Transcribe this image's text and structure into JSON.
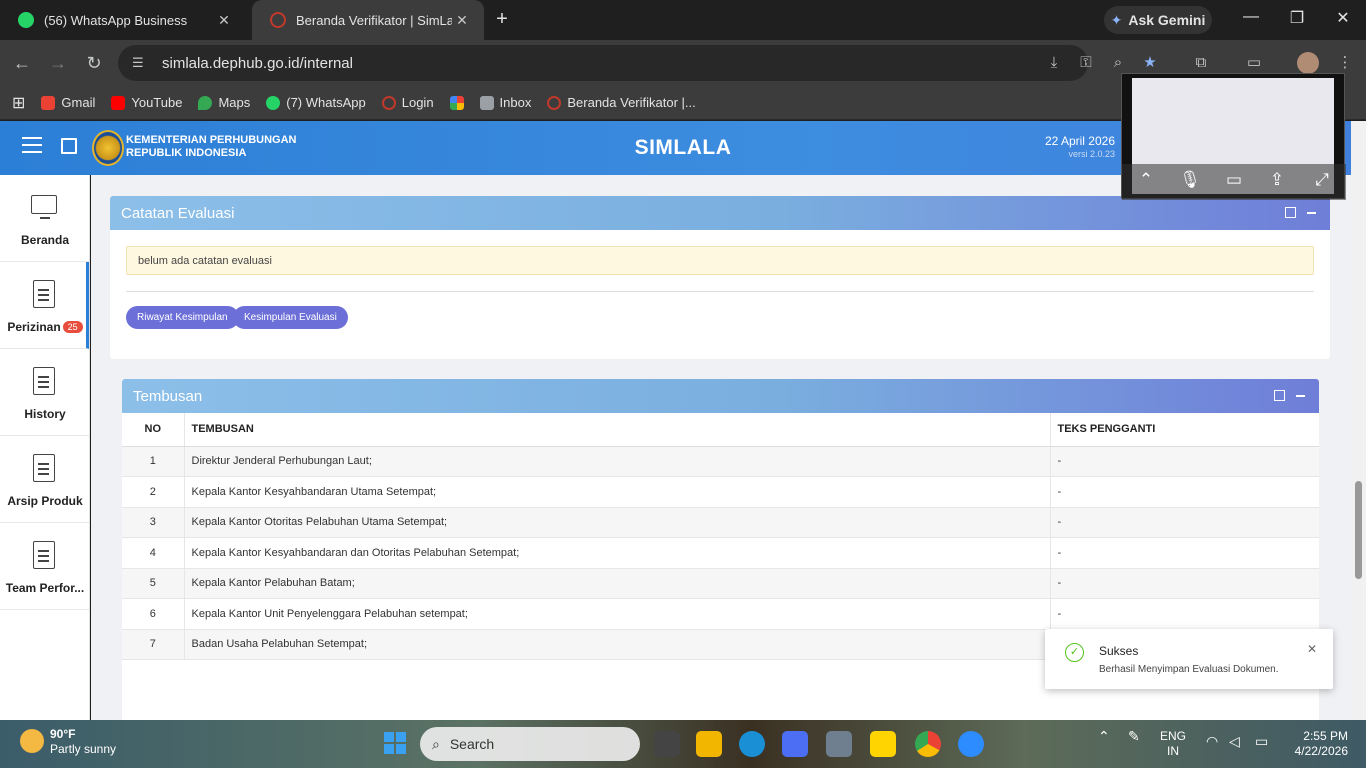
{
  "browser": {
    "tabs": [
      {
        "title": "(56) WhatsApp Business",
        "active": false
      },
      {
        "title": "Beranda Verifikator | SimLala",
        "active": true
      }
    ],
    "gemini_label": "Ask Gemini",
    "url": "simlala.dephub.go.id/internal",
    "bookmarks": [
      {
        "label": "Gmail",
        "icon": "gmail-icon",
        "color": "#ea4335"
      },
      {
        "label": "YouTube",
        "icon": "youtube-icon",
        "color": "#ff0000"
      },
      {
        "label": "Maps",
        "icon": "maps-icon",
        "color": "#34a853"
      },
      {
        "label": "(7) WhatsApp",
        "icon": "whatsapp-icon",
        "color": "#25d366"
      },
      {
        "label": "Login",
        "icon": "globe-icon",
        "color": "#c0392b"
      },
      {
        "label": "",
        "icon": "pinwheel-icon",
        "color": "#fbbc05"
      },
      {
        "label": "Inbox",
        "icon": "mail-icon",
        "color": "#9aa0a6"
      },
      {
        "label": "Beranda Verifikator |...",
        "icon": "globe-icon",
        "color": "#c0392b"
      }
    ]
  },
  "header": {
    "org_line1": "KEMENTERIAN PERHUBUNGAN",
    "org_line2": "REPUBLIK INDONESIA",
    "app_name": "SIMLALA",
    "date": "22 April 2026",
    "version": "versi 2.0.23"
  },
  "sidebar": {
    "items": [
      {
        "label": "Beranda",
        "icon": "monitor-icon"
      },
      {
        "label": "Perizinan",
        "icon": "document-icon",
        "badge": "25"
      },
      {
        "label": "History",
        "icon": "document-icon"
      },
      {
        "label": "Arsip Produk",
        "icon": "document-icon"
      },
      {
        "label": "Team Perfor...",
        "icon": "document-icon"
      }
    ]
  },
  "catatan": {
    "title": "Catatan Evaluasi",
    "note": "belum ada catatan evaluasi",
    "buttons": [
      "Riwayat Kesimpulan",
      "Kesimpulan Evaluasi"
    ]
  },
  "tembusan": {
    "title": "Tembusan",
    "columns": [
      "NO",
      "TEMBUSAN",
      "TEKS PENGGANTI"
    ],
    "rows": [
      {
        "no": "1",
        "tembusan": "Direktur Jenderal Perhubungan Laut;",
        "teks": "-"
      },
      {
        "no": "2",
        "tembusan": "Kepala Kantor Kesyahbandaran Utama Setempat;",
        "teks": "-"
      },
      {
        "no": "3",
        "tembusan": "Kepala Kantor Otoritas Pelabuhan Utama Setempat;",
        "teks": "-"
      },
      {
        "no": "4",
        "tembusan": "Kepala Kantor Kesyahbandaran dan Otoritas Pelabuhan Setempat;",
        "teks": "-"
      },
      {
        "no": "5",
        "tembusan": "Kepala Kantor Pelabuhan Batam;",
        "teks": "-"
      },
      {
        "no": "6",
        "tembusan": "Kepala Kantor Unit Penyelenggara Pelabuhan setempat;",
        "teks": "-"
      },
      {
        "no": "7",
        "tembusan": "Badan Usaha Pelabuhan Setempat;",
        "teks": ""
      }
    ]
  },
  "toast": {
    "title": "Sukses",
    "message": "Berhasil Menyimpan Evaluasi Dokumen."
  },
  "taskbar": {
    "temp": "90°F",
    "weather": "Partly sunny",
    "search_placeholder": "Search",
    "lang1": "ENG",
    "lang2": "IN",
    "time": "2:55 PM",
    "date": "4/22/2026"
  },
  "colors": {
    "header_blue": "#2c7fd6",
    "button_purple": "#6c6fd8",
    "success_green": "#52c41a",
    "badge_red": "#e74c3c"
  }
}
